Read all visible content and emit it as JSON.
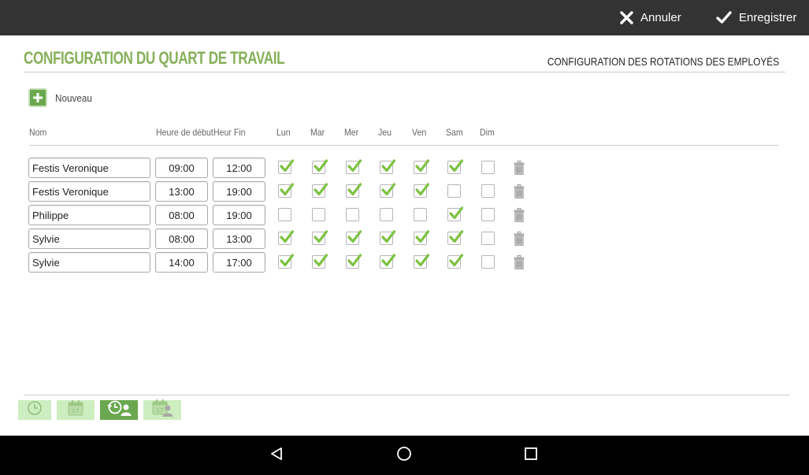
{
  "topbar": {
    "cancel_label": "Annuler",
    "save_label": "Enregistrer"
  },
  "page": {
    "title": "CONFIGURATION DU QUART DE TRAVAIL",
    "subtitle_link": "CONFIGURATION DES ROTATIONS DES EMPLOYÉS",
    "new_label": "Nouveau"
  },
  "columns": {
    "name": "Nom",
    "start": "Heure de début",
    "end": "Heur Fin",
    "days": [
      "Lun",
      "Mar",
      "Mer",
      "Jeu",
      "Ven",
      "Sam",
      "Dim"
    ]
  },
  "shifts": [
    {
      "name": "Festis Veronique",
      "start": "09:00",
      "end": "12:00",
      "days": [
        true,
        true,
        true,
        true,
        true,
        true,
        false
      ]
    },
    {
      "name": "Festis Veronique",
      "start": "13:00",
      "end": "19:00",
      "days": [
        true,
        true,
        true,
        true,
        true,
        false,
        false
      ]
    },
    {
      "name": "Philippe",
      "start": "08:00",
      "end": "19:00",
      "days": [
        false,
        false,
        false,
        false,
        false,
        true,
        false
      ]
    },
    {
      "name": "Sylvie",
      "start": "08:00",
      "end": "13:00",
      "days": [
        true,
        true,
        true,
        true,
        true,
        true,
        false
      ]
    },
    {
      "name": "Sylvie",
      "start": "14:00",
      "end": "17:00",
      "days": [
        true,
        true,
        true,
        true,
        true,
        true,
        false
      ]
    }
  ],
  "bottom_tabs": [
    {
      "icon": "clock-icon",
      "active": false
    },
    {
      "icon": "calendar-icon",
      "active": false
    },
    {
      "icon": "clock-user-icon",
      "active": true
    },
    {
      "icon": "calendar-user-icon",
      "active": false
    }
  ],
  "colors": {
    "accent": "#86b05a",
    "check": "#7dc243",
    "topbar": "#333333",
    "active_tab": "#6aa84f",
    "light_tab": "#cdeec0"
  }
}
